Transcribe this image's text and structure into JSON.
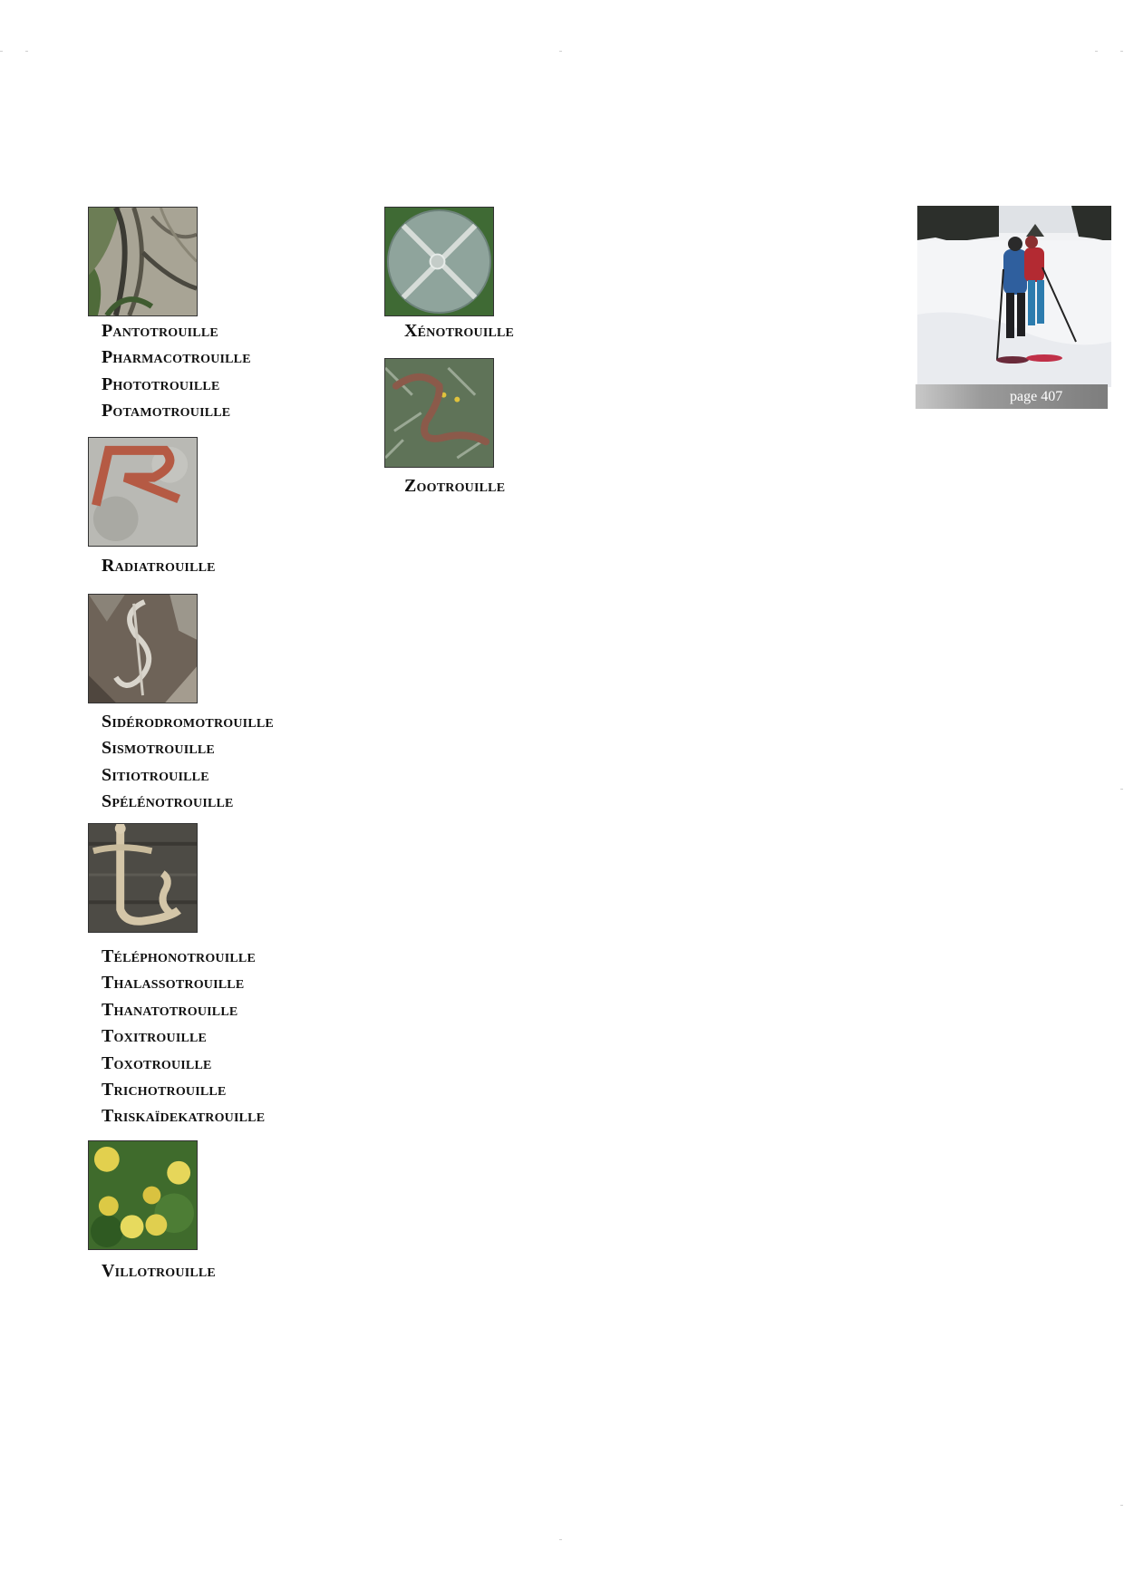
{
  "groups": [
    {
      "icon": "tree-roots-thumbnail",
      "words": [
        "Pantotrouille",
        "Pharmacotrouille",
        "Phototrouille",
        "Potamotrouille"
      ]
    },
    {
      "icon": "painted-r-letter-thumbnail",
      "words": [
        "Radiatrouille"
      ]
    },
    {
      "icon": "rock-s-letter-thumbnail",
      "words": [
        "Sidérodromotrouille",
        "Sismotrouille",
        "Sitiotrouille",
        "Spélénotrouille"
      ]
    },
    {
      "icon": "rope-t-letter-thumbnail",
      "words": [
        "Téléphonotrouille",
        "Thalassotrouille",
        "Thanatotrouille",
        "Toxitrouille",
        "Toxotrouille",
        "Trichotrouille",
        "Triskaïdekatrouille"
      ]
    },
    {
      "icon": "yellow-fruits-v-thumbnail",
      "words": [
        "Villotrouille"
      ]
    },
    {
      "icon": "glass-disc-x-thumbnail",
      "words": [
        "Xénotrouille"
      ]
    },
    {
      "icon": "branch-z-letter-thumbnail",
      "words": [
        "Zootrouille"
      ]
    }
  ],
  "page_label": "page 407",
  "photo": {
    "icon": "snowshoe-hikers-photo"
  },
  "colors": {
    "page_bar": "#8a8a8a",
    "text": "#111111"
  }
}
